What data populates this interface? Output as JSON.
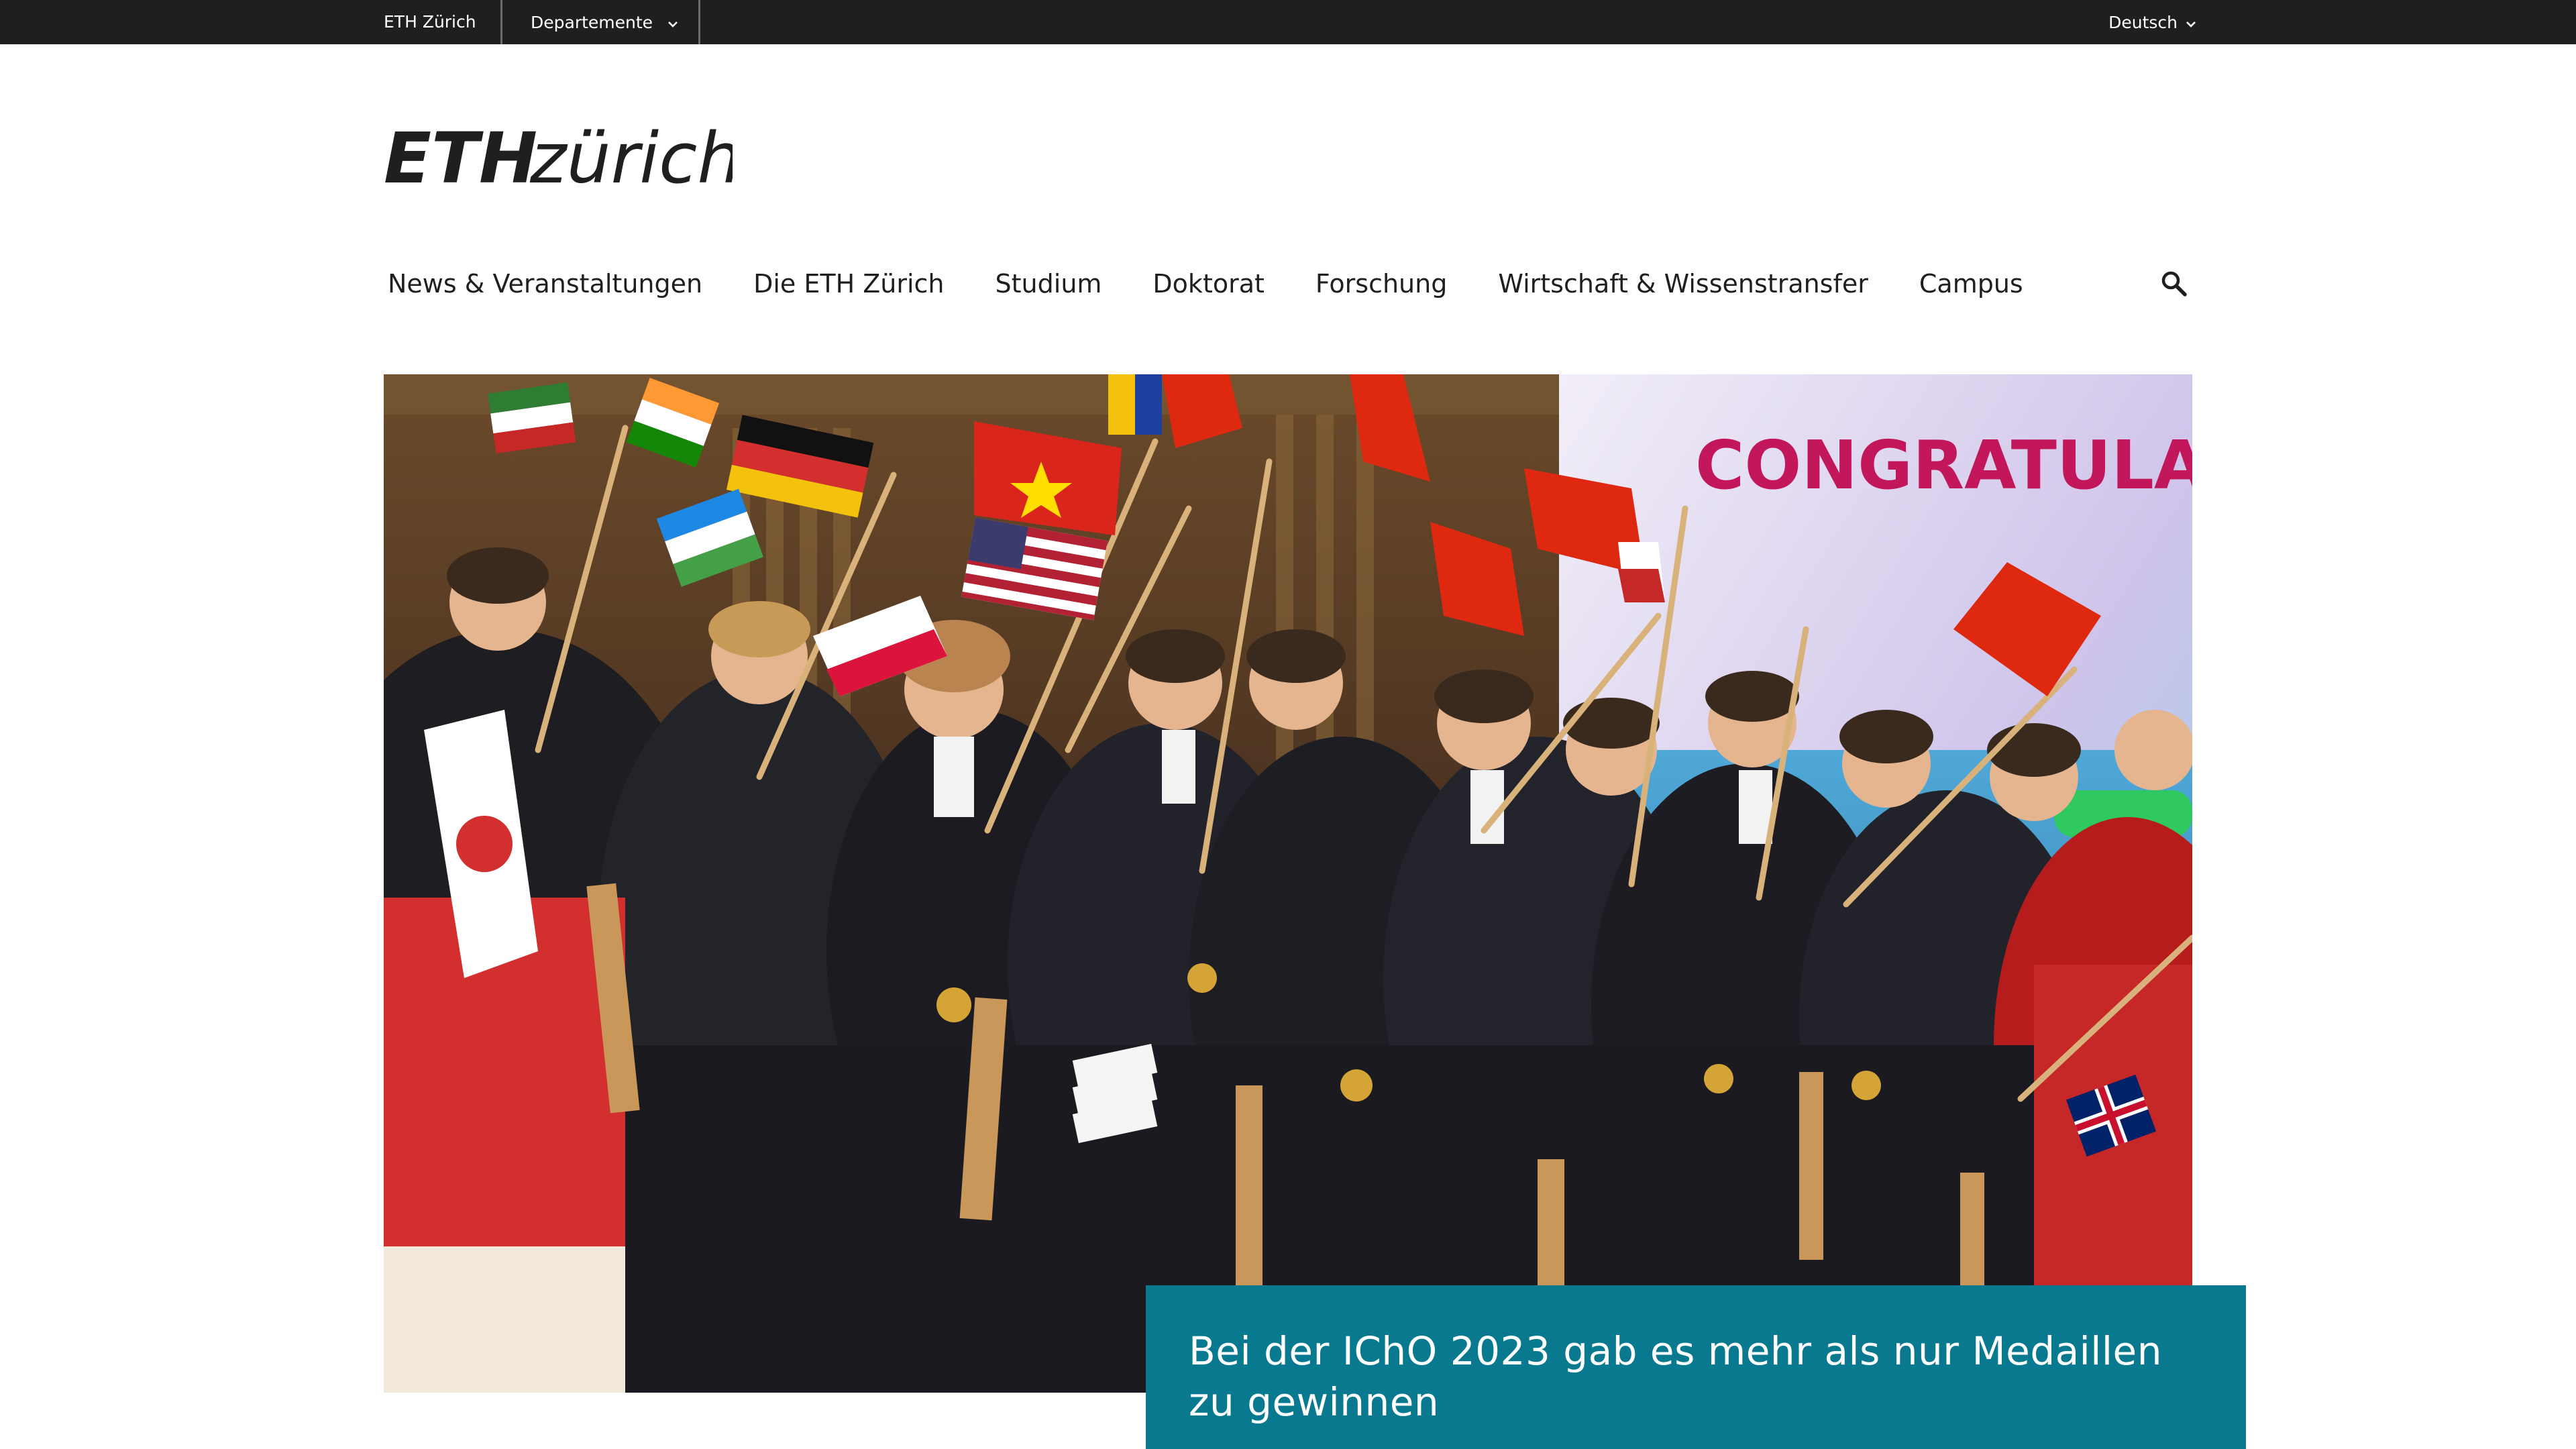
{
  "topbar": {
    "home_label": "ETH Zürich",
    "departments_label": "Departemente",
    "language_label": "Deutsch"
  },
  "logo": {
    "eth": "ETH",
    "zurich": "zürich"
  },
  "nav": {
    "items": [
      "News & Veranstaltungen",
      "Die ETH Zürich",
      "Studium",
      "Doktorat",
      "Forschung",
      "Wirtschaft & Wissenstransfer",
      "Campus"
    ]
  },
  "hero": {
    "screen_text": "CONGRATULATIO",
    "teaser_title": "Bei der IChO 2023 gab es mehr als nur Medaillen zu gewinnen"
  },
  "colors": {
    "topbar_bg": "#1f1f1f",
    "teaser_bg": "#08798f",
    "text": "#1f1f1f"
  },
  "icons": {
    "search": "search-icon",
    "dropdown": "chevron-down-icon"
  }
}
